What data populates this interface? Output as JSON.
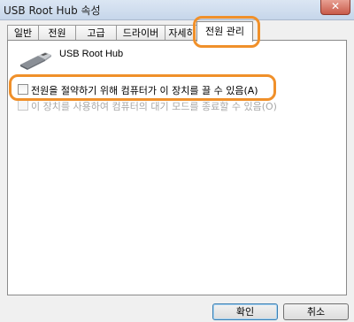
{
  "window": {
    "title": "USB Root Hub 속성",
    "close_glyph": "✕"
  },
  "tabs": [
    {
      "label": "일반"
    },
    {
      "label": "전원"
    },
    {
      "label": "고급"
    },
    {
      "label": "드라이버"
    },
    {
      "label": "자세히"
    },
    {
      "label": "전원 관리",
      "active": true
    }
  ],
  "device": {
    "icon": "usb-plug-icon",
    "name": "USB Root Hub"
  },
  "options": [
    {
      "label": "전원을 절약하기 위해 컴퓨터가 이 장치를 끌 수 있음(A)",
      "checked": false,
      "enabled": true
    },
    {
      "label": "이 장치를 사용하여 컴퓨터의 대기 모드를 종료할 수 있음(O)",
      "checked": false,
      "enabled": false
    }
  ],
  "buttons": {
    "ok": "확인",
    "cancel": "취소"
  },
  "highlight_color": "#f0902a"
}
